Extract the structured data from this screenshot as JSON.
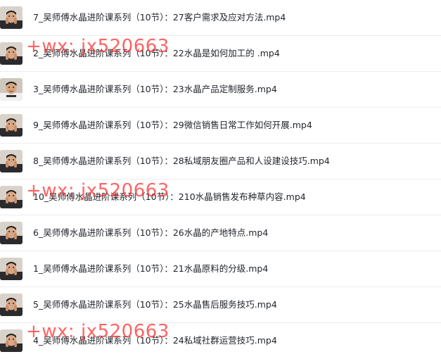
{
  "files": [
    {
      "name": "7_吴师傅水晶进阶课系列（10节）：27客户需求及应对方法.mp4",
      "thumbnail_icon": "video-thumbnail-speaker"
    },
    {
      "name": "2_吴师傅水晶进阶课系列（10节）：22水晶是如何加工的 .mp4",
      "thumbnail_icon": "video-thumbnail-speaker"
    },
    {
      "name": "3_吴师傅水晶进阶课系列（10节）：23水晶产品定制服务.mp4",
      "thumbnail_icon": "video-thumbnail-speaker"
    },
    {
      "name": "9_吴师傅水晶进阶课系列（10节）：29微信销售日常工作如何开展.mp4",
      "thumbnail_icon": "video-thumbnail-speaker"
    },
    {
      "name": "8_吴师傅水晶进阶课系列（10节）：28私域朋友圈产品和人设建设技巧.mp4",
      "thumbnail_icon": "video-thumbnail-speaker"
    },
    {
      "name": "10_吴师傅水晶进阶课系列（10节）：210水晶销售发布种草内容.mp4",
      "thumbnail_icon": "video-thumbnail-speaker"
    },
    {
      "name": "6_吴师傅水晶进阶课系列（10节）：26水晶的产地特点.mp4",
      "thumbnail_icon": "video-thumbnail-speaker"
    },
    {
      "name": "1_吴师傅水晶进阶课系列（10节）：21水晶原料的分级.mp4",
      "thumbnail_icon": "video-thumbnail-speaker"
    },
    {
      "name": "5_吴师傅水晶进阶课系列（10节）：25水晶售后服务技巧.mp4",
      "thumbnail_icon": "video-thumbnail-speaker"
    },
    {
      "name": "4_吴师傅水晶进阶课系列（10节）：24私域社群运营技巧.mp4",
      "thumbnail_icon": "video-thumbnail-speaker"
    }
  ],
  "watermark": {
    "text": "+wx: jx520663",
    "color": "#ff2828"
  }
}
